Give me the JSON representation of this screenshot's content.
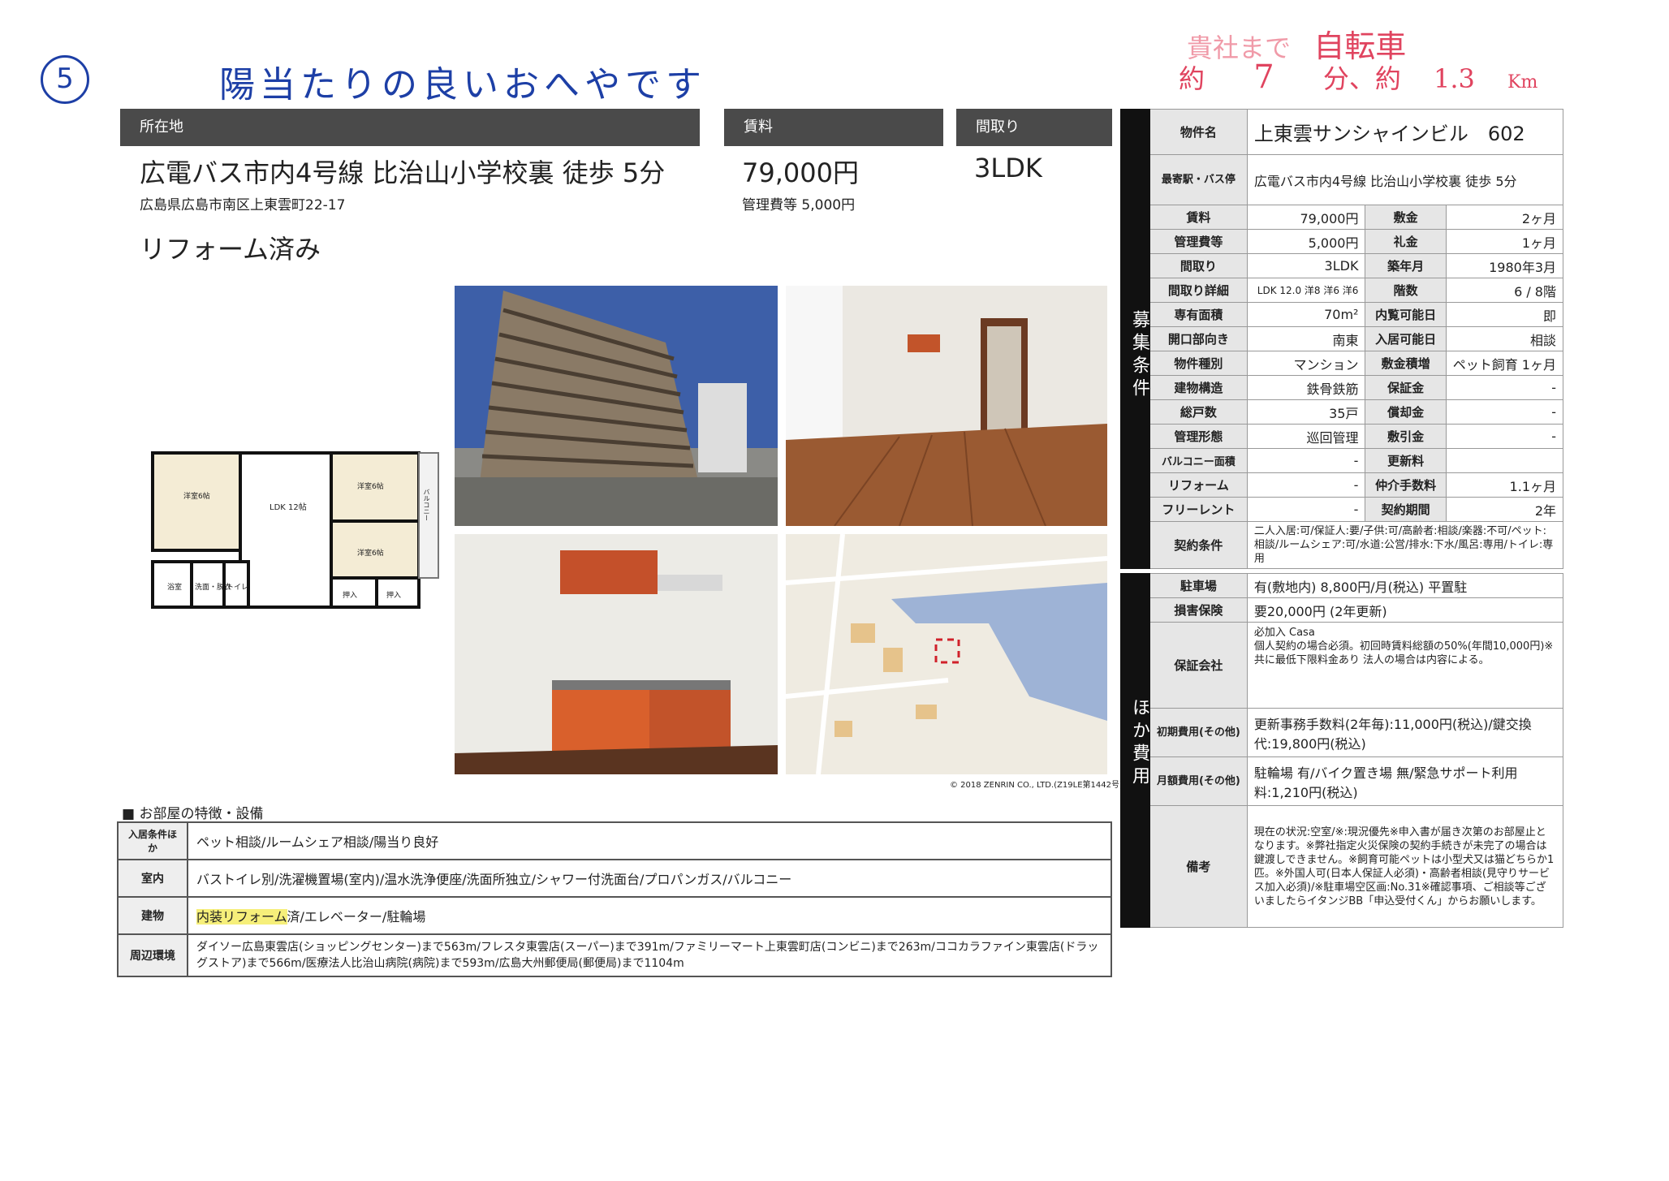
{
  "handwritten": {
    "circle_number": "5",
    "note": "陽当たりの良いおへやです",
    "distance_line1_a": "貴社まで",
    "distance_line1_b": "自転車",
    "distance_line2_a": "約",
    "distance_line2_b": "7",
    "distance_line2_c": "分、約",
    "distance_line2_d": "1.3",
    "distance_line2_e": "Km"
  },
  "headers": {
    "location": "所在地",
    "rent": "賃料",
    "layout": "間取り"
  },
  "main": {
    "access": "広電バス市内4号線 比治山小学校裏 徒歩 5分",
    "address": "広島県広島市南区上東雲町22-17",
    "rent": "79,000円",
    "management_fee": "管理費等 5,000円",
    "layout": "3LDK",
    "tagline": "リフォーム済み"
  },
  "floorplan": {
    "room_left": "洋室6帖",
    "ldk": "LDK 12帖",
    "room_right_top": "洋室6帖",
    "room_right_bottom": "洋室6帖",
    "bath": "浴室",
    "wash": "洗面・脱衣",
    "toilet": "トイレ",
    "closet1": "押入",
    "closet2": "押入",
    "balcony": "バルコニー"
  },
  "map_copyright": "© 2018 ZENRIN CO., LTD.(Z19LE第1442号)",
  "property_table": {
    "side_label_conditions": "募集条件",
    "side_label_other": "ほか費用",
    "name_key": "物件名",
    "name_value": "上東雲サンシャインビル　602",
    "station_key": "最寄駅・バス停",
    "station_value": "広電バス市内4号線 比治山小学校裏 徒歩 5分",
    "rows": [
      {
        "k1": "賃料",
        "v1": "79,000円",
        "k2": "敷金",
        "v2": "2ヶ月"
      },
      {
        "k1": "管理費等",
        "v1": "5,000円",
        "k2": "礼金",
        "v2": "1ヶ月"
      },
      {
        "k1": "間取り",
        "v1": "3LDK",
        "k2": "築年月",
        "v2": "1980年3月"
      },
      {
        "k1": "間取り詳細",
        "v1": "LDK 12.0 洋8 洋6 洋6",
        "k2": "階数",
        "v2": "6 / 8階"
      },
      {
        "k1": "専有面積",
        "v1": "70m²",
        "k2": "内覧可能日",
        "v2": "即"
      },
      {
        "k1": "開口部向き",
        "v1": "南東",
        "k2": "入居可能日",
        "v2": "相談"
      },
      {
        "k1": "物件種別",
        "v1": "マンション",
        "k2": "敷金積増",
        "v2": "ペット飼育 1ヶ月"
      },
      {
        "k1": "建物構造",
        "v1": "鉄骨鉄筋",
        "k2": "保証金",
        "v2": "-"
      },
      {
        "k1": "総戸数",
        "v1": "35戸",
        "k2": "償却金",
        "v2": "-"
      },
      {
        "k1": "管理形態",
        "v1": "巡回管理",
        "k2": "敷引金",
        "v2": "-"
      },
      {
        "k1": "バルコニー面積",
        "v1": "-",
        "k2": "更新料",
        "v2": ""
      },
      {
        "k1": "リフォーム",
        "v1": "-",
        "k2": "仲介手数料",
        "v2": "1.1ヶ月"
      },
      {
        "k1": "フリーレント",
        "v1": "-",
        "k2": "契約期間",
        "v2": "2年"
      }
    ],
    "contract_key": "契約条件",
    "contract_value": "二人入居:可/保証人:要/子供:可/高齢者:相談/楽器:不可/ペット:相談/ルームシェア:可/水道:公営/排水:下水/風呂:専用/トイレ:専用",
    "parking_key": "駐車場",
    "parking_value": "有(敷地内) 8,800円/月(税込) 平置駐",
    "insurance_key": "損害保険",
    "insurance_value": "要20,000円 (2年更新)",
    "guarantor_key": "保証会社",
    "guarantor_value": "必加入 Casa\n個人契約の場合必須。初回時賃料総額の50%(年間10,000円)※共に最低下限料金あり 法人の場合は内容による。",
    "initial_key": "初期費用(その他)",
    "initial_value": "更新事務手数料(2年毎):11,000円(税込)/鍵交換代:19,800円(税込)",
    "monthly_key": "月額費用(その他)",
    "monthly_value": "駐輪場 有/バイク置き場 無/緊急サポート利用料:1,210円(税込)",
    "remarks_key": "備考",
    "remarks_value": "現在の状況:空室/※:現況優先※申入書が届き次第のお部屋止となります。※弊社指定火災保険の契約手続きが未完了の場合は鍵渡しできません。※飼育可能ペットは小型犬又は猫どちらか1匹。※外国人可(日本人保証人必須)・高齢者相談(見守りサービス加入必須)/※駐車場空区画:No.31※確認事項、ご相談等ございましたらイタンジBB「申込受付くん」からお願いします。"
  },
  "features": {
    "title": "■ お部屋の特徴・設備",
    "rows": [
      {
        "k": "入居条件ほか",
        "v": "ペット相談/ルームシェア相談/陽当り良好"
      },
      {
        "k": "室内",
        "v": "バストイレ別/洗濯機置場(室内)/温水洗浄便座/洗面所独立/シャワー付洗面台/プロパンガス/バルコニー"
      },
      {
        "k": "建物",
        "v_hl": "内装リフォーム",
        "v": "済/エレベーター/駐輪場"
      },
      {
        "k": "周辺環境",
        "v": "ダイソー広島東雲店(ショッピングセンター)まで563m/フレスタ東雲店(スーパー)まで391m/ファミリーマート上東雲町店(コンビニ)まで263m/ココカラファイン東雲店(ドラッグストア)まで566m/医療法人比治山病院(病院)まで593m/広島大州郵便局(郵便局)まで1104m"
      }
    ]
  }
}
